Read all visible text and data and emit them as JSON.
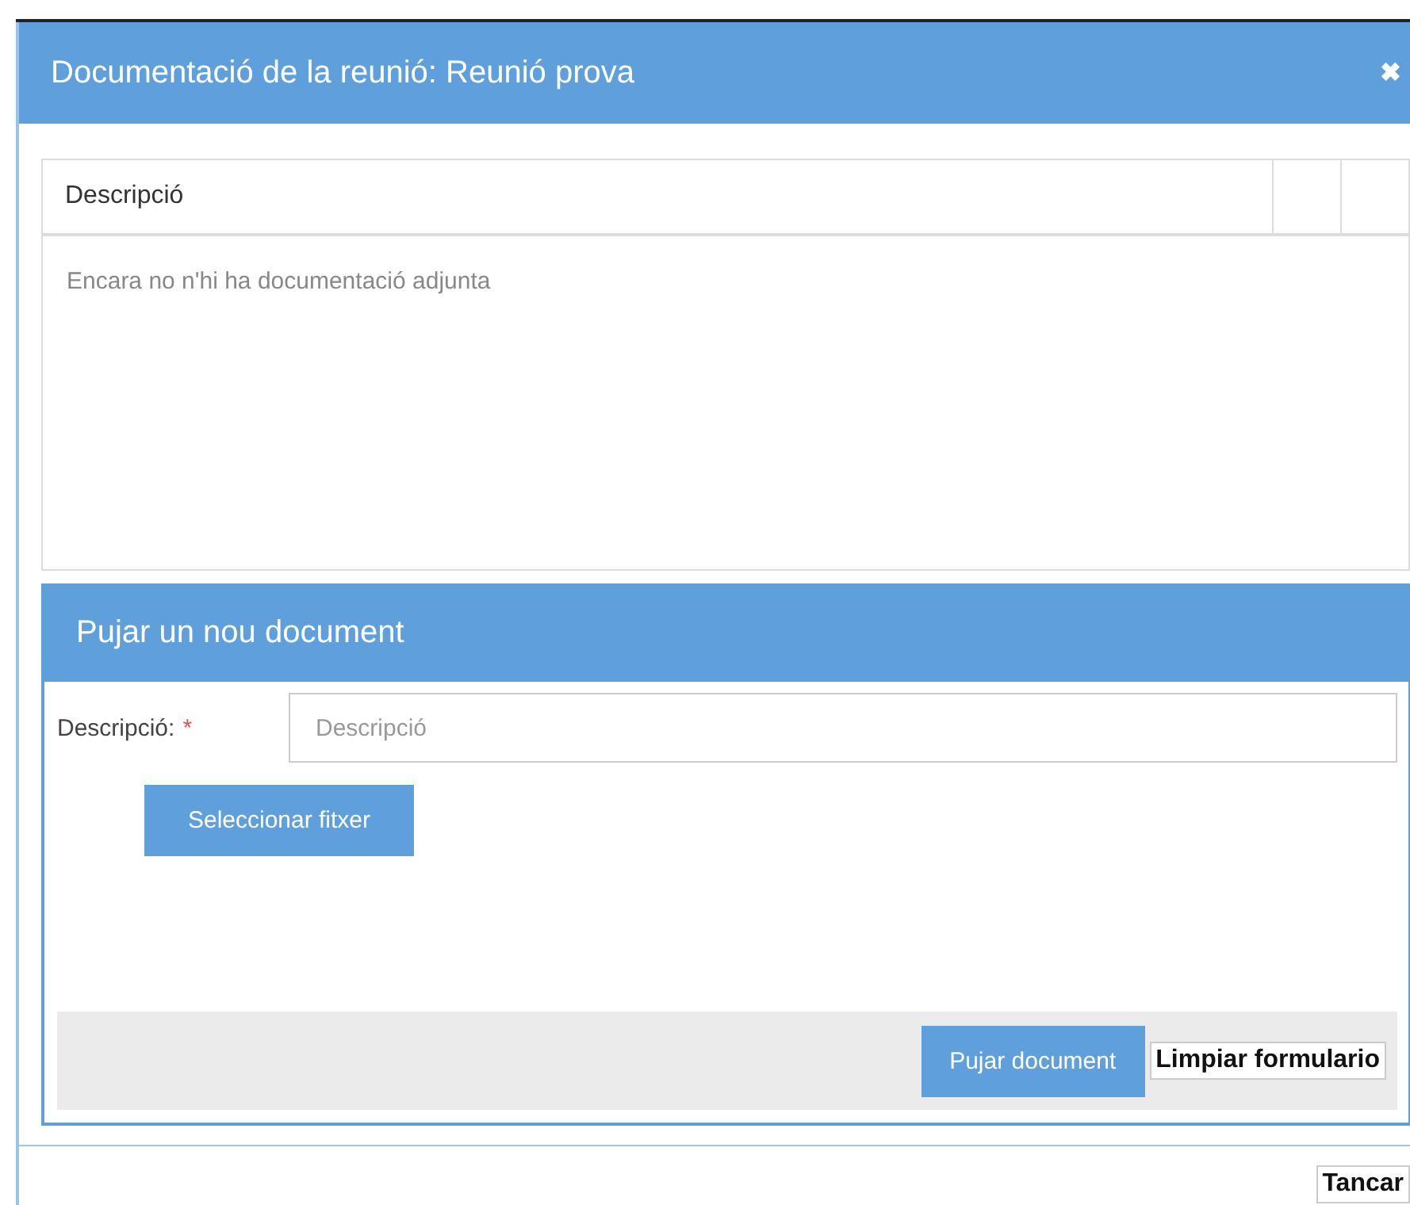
{
  "dialog": {
    "title": "Documentació de la reunió: Reunió prova",
    "close_icon": "✖"
  },
  "table": {
    "columns": [
      "Descripció"
    ],
    "empty_message": "Encara no n'hi ha documentació adjunta"
  },
  "upload": {
    "title": "Pujar un nou document",
    "field": {
      "label": "Descripció:",
      "required_mark": "*",
      "placeholder": "Descripció"
    },
    "select_button": "Seleccionar fitxer",
    "buttons": [
      {
        "label": "Pujar document",
        "kind": "primary"
      },
      {
        "label": "Limpiar formulario",
        "kind": "plain"
      }
    ]
  },
  "footer": {
    "buttons": [
      {
        "label": "Tancar",
        "kind": "plain"
      }
    ]
  }
}
